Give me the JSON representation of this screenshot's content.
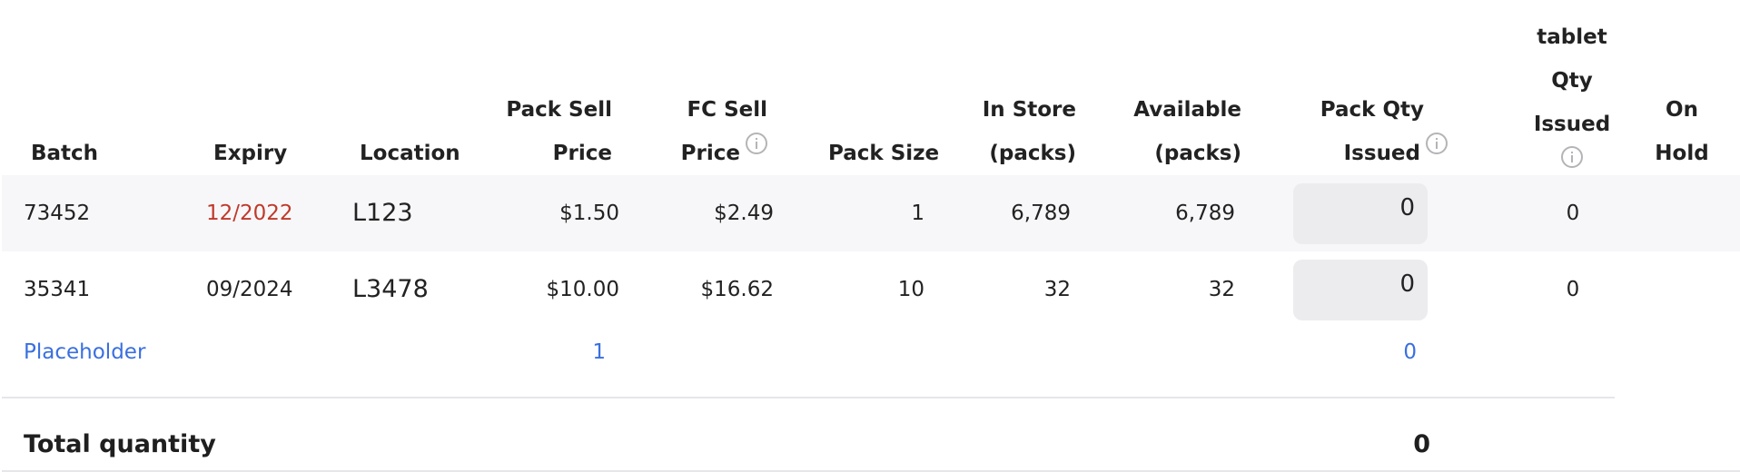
{
  "headers": {
    "batch": "Batch",
    "expiry": "Expiry",
    "location": "Location",
    "pack_sell_price": [
      "Pack Sell",
      "Price"
    ],
    "fc_sell_price": [
      "FC Sell",
      "Price"
    ],
    "pack_size": "Pack Size",
    "in_store": [
      "In Store",
      "(packs)"
    ],
    "available": [
      "Available",
      "(packs)"
    ],
    "pack_qty_issued": [
      "Pack Qty",
      "Issued"
    ],
    "tablet_qty_issued": [
      "tablet",
      "Qty",
      "Issued"
    ],
    "on_hold": [
      "On",
      "Hold"
    ]
  },
  "rows": [
    {
      "batch": "73452",
      "expiry": "12/2022",
      "expiry_expired": true,
      "location": "L123",
      "pack_sell_price": "$1.50",
      "fc_sell_price": "$2.49",
      "pack_size": "1",
      "in_store": "6,789",
      "available": "6,789",
      "pack_qty_issued": "0",
      "tablet_qty_issued": "0"
    },
    {
      "batch": "35341",
      "expiry": "09/2024",
      "expiry_expired": false,
      "location": "L3478",
      "pack_sell_price": "$10.00",
      "fc_sell_price": "$16.62",
      "pack_size": "10",
      "in_store": "32",
      "available": "32",
      "pack_qty_issued": "0",
      "tablet_qty_issued": "0"
    }
  ],
  "placeholder_row": {
    "label": "Placeholder",
    "pack_sell_value": "1",
    "pack_qty_value": "0"
  },
  "total": {
    "label": "Total quantity",
    "value": "0"
  },
  "colors": {
    "expired": "#c0392b",
    "link": "#3a6fe0",
    "row_alt": "#f7f7f9",
    "input_bg": "#ececef"
  }
}
